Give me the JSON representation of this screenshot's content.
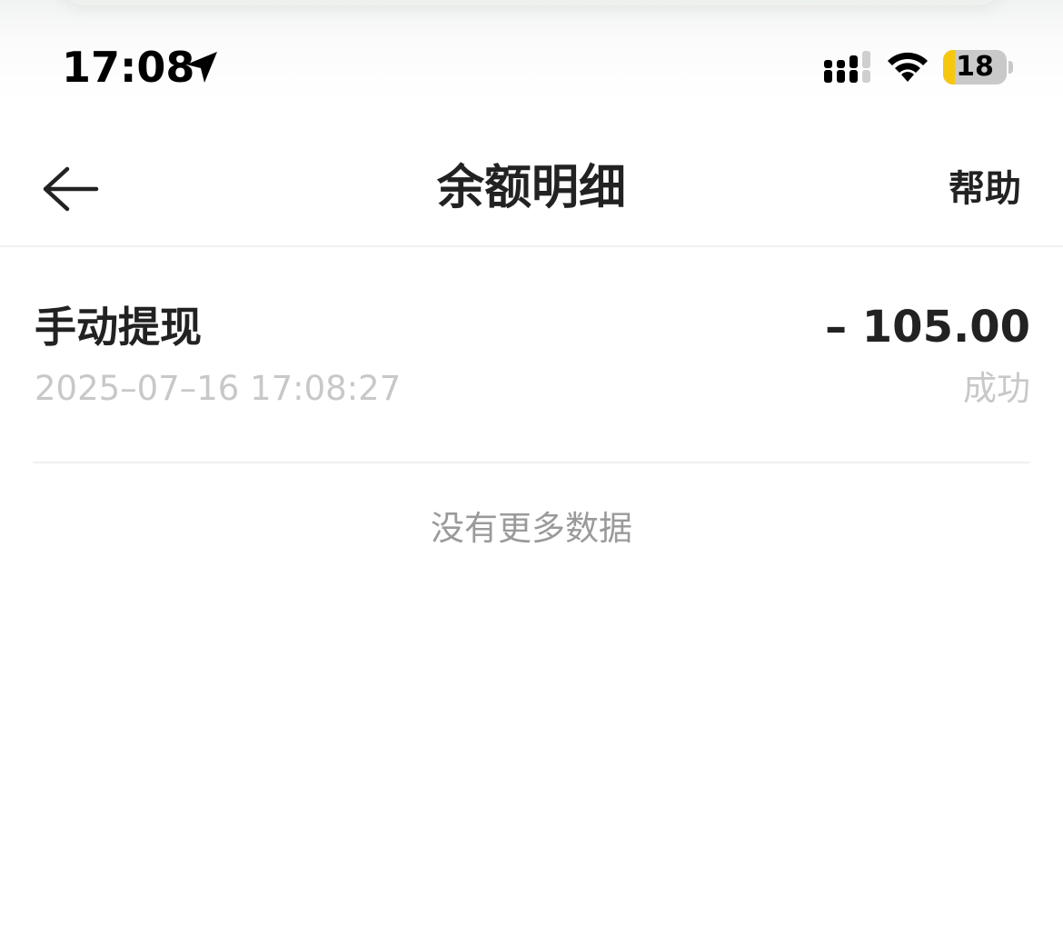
{
  "status_bar": {
    "time": "17:08",
    "battery_level": "18",
    "battery_fraction": 0.18,
    "icons": [
      "location-arrow-icon",
      "cellular-signal-icon",
      "wifi-icon",
      "battery-icon"
    ]
  },
  "nav": {
    "title": "余额明细",
    "help_label": "帮助",
    "back_icon": "back-arrow-icon"
  },
  "records": [
    {
      "title": "手动提现",
      "amount": "– 105.00",
      "time": "2025–07–16 17:08:27",
      "status": "成功"
    }
  ],
  "footer": {
    "no_more_text": "没有更多数据"
  },
  "colors": {
    "battery_fill": "#f6c70f",
    "muted_text": "#c8c8c8",
    "secondary_text": "#9a9a9a"
  }
}
